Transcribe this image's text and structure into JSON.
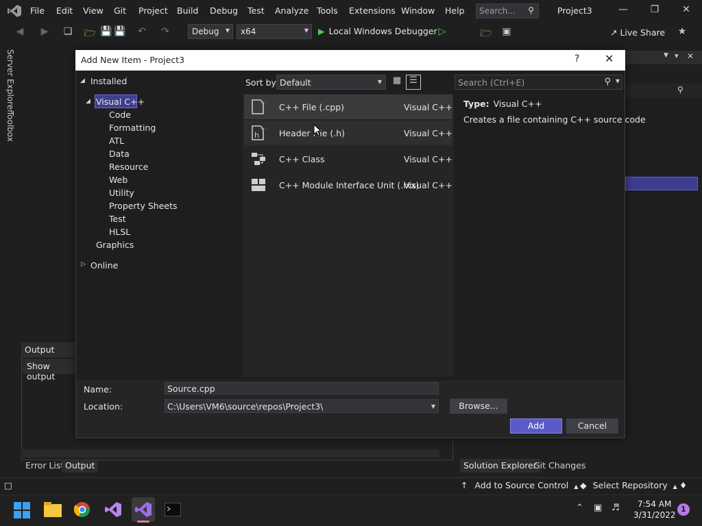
{
  "menubar": {
    "items": [
      "File",
      "Edit",
      "View",
      "Git",
      "Project",
      "Build",
      "Debug",
      "Test",
      "Analyze",
      "Tools",
      "Extensions",
      "Window",
      "Help"
    ],
    "search_placeholder": "Search...",
    "project_title": "Project3"
  },
  "toolbar": {
    "config": "Debug",
    "platform": "x64",
    "run_label": "Local Windows Debugger",
    "live_share": "Live Share"
  },
  "left_tabs": {
    "server_explorer": "Server Explorer",
    "toolbox": "Toolbox"
  },
  "output_panel": {
    "title": "Output",
    "show_output": "Show output"
  },
  "bottom_tabs": {
    "error_list": "Error List",
    "output": "Output",
    "solution_explorer": "Solution Explorer",
    "git_changes": "Git Changes"
  },
  "statusbar": {
    "add_source_control": "Add to Source Control",
    "select_repository": "Select Repository"
  },
  "taskbar": {
    "time": "7:54 AM",
    "date": "3/31/2022",
    "notifications": "1"
  },
  "dialog": {
    "title": "Add New Item - Project3",
    "help": "?",
    "tree": {
      "installed": "Installed",
      "visual_cpp": "Visual C++",
      "children": [
        "Code",
        "Formatting",
        "ATL",
        "Data",
        "Resource",
        "Web",
        "Utility",
        "Property Sheets",
        "Test",
        "HLSL"
      ],
      "graphics": "Graphics",
      "online": "Online"
    },
    "sort_label": "Sort by:",
    "sort_value": "Default",
    "items": [
      {
        "name": "C++ File (.cpp)",
        "lang": "Visual C++"
      },
      {
        "name": "Header File (.h)",
        "lang": "Visual C++"
      },
      {
        "name": "C++ Class",
        "lang": "Visual C++"
      },
      {
        "name": "C++ Module Interface Unit (.ixx)",
        "lang": "Visual C++"
      }
    ],
    "search_placeholder": "Search (Ctrl+E)",
    "info": {
      "type_label": "Type:",
      "type_value": "Visual C++",
      "description": "Creates a file containing C++ source code"
    },
    "form": {
      "name_label": "Name:",
      "name_value": "Source.cpp",
      "location_label": "Location:",
      "location_value": "C:\\Users\\VM6\\source\\repos\\Project3\\",
      "browse": "Browse...",
      "add": "Add",
      "cancel": "Cancel"
    }
  },
  "colors": {
    "accent": "#5b5bc8",
    "selection": "#3f3f8f",
    "run_green": "#4ec94e"
  }
}
